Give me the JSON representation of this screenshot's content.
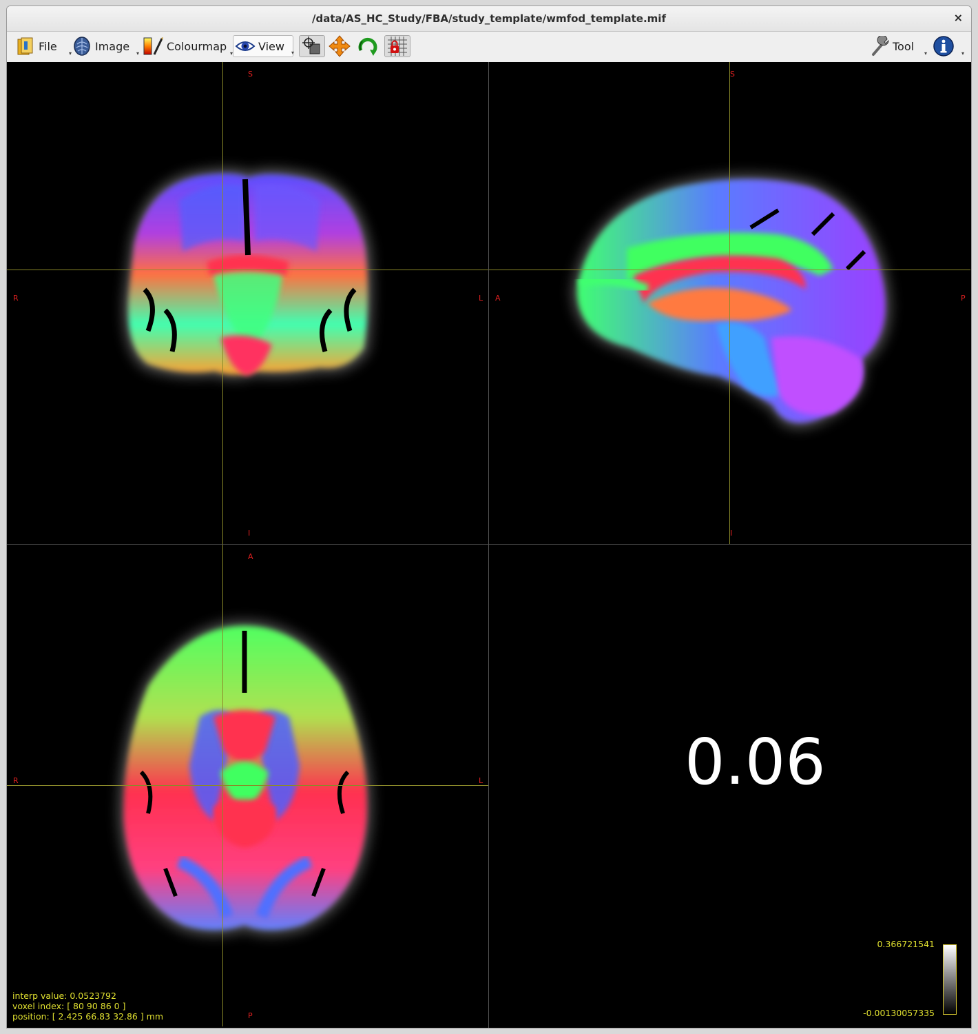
{
  "window": {
    "title": "/data/AS_HC_Study/FBA/study_template/wmfod_template.mif",
    "close_glyph": "×"
  },
  "toolbar": {
    "file_label": "File",
    "image_label": "Image",
    "colourmap_label": "Colourmap",
    "view_label": "View",
    "tool_label": "Tool",
    "icons": [
      "file-icon",
      "image-icon",
      "colourmap-icon",
      "view-eye-icon",
      "crosshair-icon",
      "pan-icon",
      "rotate-icon",
      "lock-grid-icon",
      "wrench-icon",
      "info-icon"
    ]
  },
  "views": {
    "coronal": {
      "top": "S",
      "bottom": "I",
      "left": "R",
      "right": "L"
    },
    "sagittal": {
      "top": "S",
      "bottom": "I",
      "left": "A",
      "right": "P"
    },
    "axial": {
      "top": "A",
      "bottom": "P",
      "left": "R",
      "right": "L"
    }
  },
  "value_display": "0.06",
  "status": {
    "interp_value": "interp value: 0.0523792",
    "voxel_index": "voxel index: [ 80 90 86 0 ]",
    "position": "position: [ 2.425 66.83 32.86 ] mm"
  },
  "colorbar": {
    "max": "0.366721541",
    "min": "-0.00130057335"
  },
  "colors": {
    "crosshair": "#8b8a2a",
    "orientation_label": "#e02020",
    "overlay_text": "#e0e030"
  }
}
